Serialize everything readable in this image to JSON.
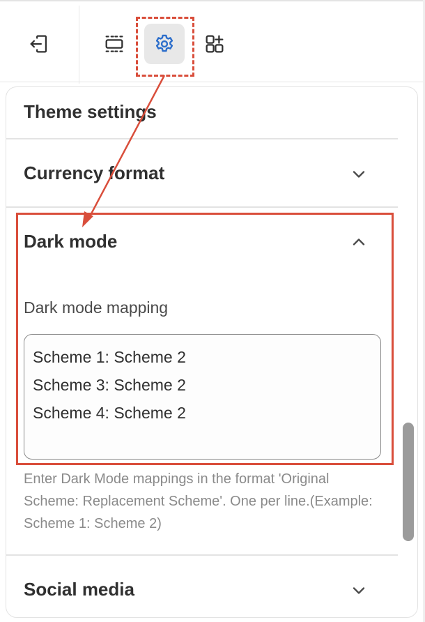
{
  "colors": {
    "annotation_red": "#d94e3b",
    "accent_blue": "#2c6ecb",
    "text": "#303030",
    "muted": "#8a8a8a"
  },
  "toolbar": {
    "buttons": [
      {
        "icon": "exit-icon"
      },
      {
        "icon": "sections-icon"
      },
      {
        "icon": "gear-icon",
        "active": true
      },
      {
        "icon": "add-block-icon"
      }
    ]
  },
  "panel": {
    "title": "Theme settings",
    "sections": {
      "currency": {
        "title": "Currency format",
        "chevron": "chevron-down-icon"
      },
      "dark_mode": {
        "title": "Dark mode",
        "chevron": "chevron-up-icon",
        "field_label": "Dark mode mapping",
        "lines": [
          "Scheme 1: Scheme 2",
          "Scheme 3: Scheme 2",
          "Scheme 4: Scheme 2"
        ],
        "help_text": "Enter Dark Mode mappings in the format 'Original Scheme: Replacement Scheme'. One per line.(Example: Scheme 1: Scheme 2)"
      },
      "social": {
        "title": "Social media",
        "chevron": "chevron-down-icon"
      }
    }
  }
}
